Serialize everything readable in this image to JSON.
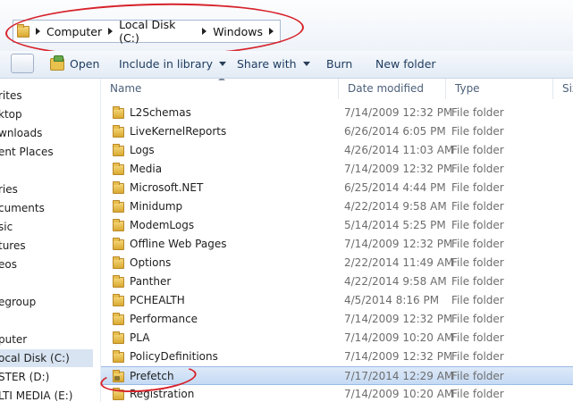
{
  "address": {
    "crumbs": [
      "Computer",
      "Local Disk (C:)",
      "Windows"
    ]
  },
  "toolbar": {
    "open_label": "Open",
    "include_label": "Include in library",
    "share_label": "Share with",
    "burn_label": "Burn",
    "new_folder_label": "New folder"
  },
  "nav": {
    "items": [
      "rites",
      "ktop",
      "wnloads",
      "ent Places",
      "ries",
      "cuments",
      "sic",
      "tures",
      "eos",
      "egroup",
      "puter",
      "ocal Disk (C:)",
      "STER  (D:)",
      "LTI MEDIA (E:)"
    ]
  },
  "columns": {
    "name": "Name",
    "date": "Date modified",
    "type": "Type",
    "size": "Size"
  },
  "files": [
    {
      "name": "L2Schemas",
      "date": "7/14/2009 12:32 PM",
      "type": "File folder"
    },
    {
      "name": "LiveKernelReports",
      "date": "6/26/2014 6:05 PM",
      "type": "File folder"
    },
    {
      "name": "Logs",
      "date": "4/26/2014 11:03 AM",
      "type": "File folder"
    },
    {
      "name": "Media",
      "date": "7/14/2009 12:32 PM",
      "type": "File folder"
    },
    {
      "name": "Microsoft.NET",
      "date": "6/25/2014 4:44 PM",
      "type": "File folder"
    },
    {
      "name": "Minidump",
      "date": "4/22/2014 9:58 AM",
      "type": "File folder"
    },
    {
      "name": "ModemLogs",
      "date": "5/14/2014 5:25 PM",
      "type": "File folder"
    },
    {
      "name": "Offline Web Pages",
      "date": "7/14/2009 12:32 PM",
      "type": "File folder"
    },
    {
      "name": "Options",
      "date": "2/22/2014 11:49 AM",
      "type": "File folder"
    },
    {
      "name": "Panther",
      "date": "4/22/2014 9:58 AM",
      "type": "File folder"
    },
    {
      "name": "PCHEALTH",
      "date": "4/5/2014 8:16 PM",
      "type": "File folder"
    },
    {
      "name": "Performance",
      "date": "7/14/2009 12:32 PM",
      "type": "File folder"
    },
    {
      "name": "PLA",
      "date": "7/14/2009 10:20 AM",
      "type": "File folder"
    },
    {
      "name": "PolicyDefinitions",
      "date": "7/14/2009 12:32 PM",
      "type": "File folder"
    },
    {
      "name": "Prefetch",
      "date": "7/17/2014 12:29 AM",
      "type": "File folder"
    },
    {
      "name": "Registration",
      "date": "7/14/2009 10:20 AM",
      "type": "File folder"
    }
  ],
  "selected_file": "Prefetch",
  "selected_nav": "ocal Disk (C:)",
  "colors": {
    "annotation": "#d7222a",
    "selection": "#c5daf4"
  }
}
